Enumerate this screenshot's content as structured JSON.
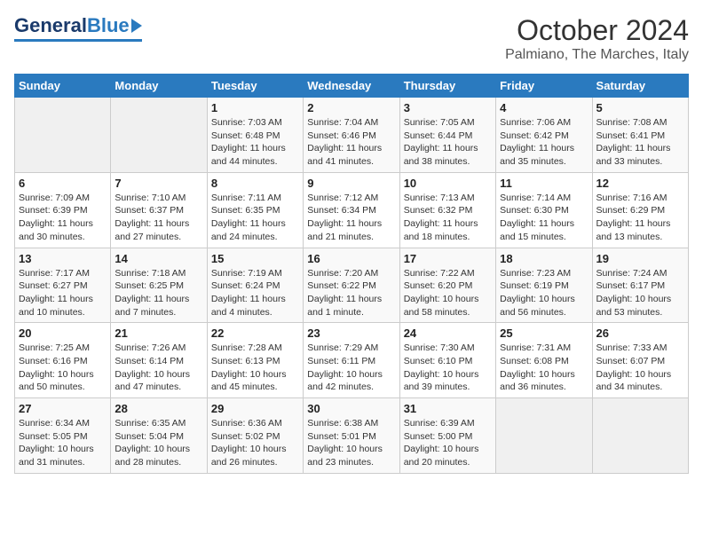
{
  "logo": {
    "general": "General",
    "blue": "Blue"
  },
  "title": "October 2024",
  "subtitle": "Palmiano, The Marches, Italy",
  "headers": [
    "Sunday",
    "Monday",
    "Tuesday",
    "Wednesday",
    "Thursday",
    "Friday",
    "Saturday"
  ],
  "weeks": [
    [
      {
        "day": "",
        "sunrise": "",
        "sunset": "",
        "daylight": ""
      },
      {
        "day": "",
        "sunrise": "",
        "sunset": "",
        "daylight": ""
      },
      {
        "day": "1",
        "sunrise": "Sunrise: 7:03 AM",
        "sunset": "Sunset: 6:48 PM",
        "daylight": "Daylight: 11 hours and 44 minutes."
      },
      {
        "day": "2",
        "sunrise": "Sunrise: 7:04 AM",
        "sunset": "Sunset: 6:46 PM",
        "daylight": "Daylight: 11 hours and 41 minutes."
      },
      {
        "day": "3",
        "sunrise": "Sunrise: 7:05 AM",
        "sunset": "Sunset: 6:44 PM",
        "daylight": "Daylight: 11 hours and 38 minutes."
      },
      {
        "day": "4",
        "sunrise": "Sunrise: 7:06 AM",
        "sunset": "Sunset: 6:42 PM",
        "daylight": "Daylight: 11 hours and 35 minutes."
      },
      {
        "day": "5",
        "sunrise": "Sunrise: 7:08 AM",
        "sunset": "Sunset: 6:41 PM",
        "daylight": "Daylight: 11 hours and 33 minutes."
      }
    ],
    [
      {
        "day": "6",
        "sunrise": "Sunrise: 7:09 AM",
        "sunset": "Sunset: 6:39 PM",
        "daylight": "Daylight: 11 hours and 30 minutes."
      },
      {
        "day": "7",
        "sunrise": "Sunrise: 7:10 AM",
        "sunset": "Sunset: 6:37 PM",
        "daylight": "Daylight: 11 hours and 27 minutes."
      },
      {
        "day": "8",
        "sunrise": "Sunrise: 7:11 AM",
        "sunset": "Sunset: 6:35 PM",
        "daylight": "Daylight: 11 hours and 24 minutes."
      },
      {
        "day": "9",
        "sunrise": "Sunrise: 7:12 AM",
        "sunset": "Sunset: 6:34 PM",
        "daylight": "Daylight: 11 hours and 21 minutes."
      },
      {
        "day": "10",
        "sunrise": "Sunrise: 7:13 AM",
        "sunset": "Sunset: 6:32 PM",
        "daylight": "Daylight: 11 hours and 18 minutes."
      },
      {
        "day": "11",
        "sunrise": "Sunrise: 7:14 AM",
        "sunset": "Sunset: 6:30 PM",
        "daylight": "Daylight: 11 hours and 15 minutes."
      },
      {
        "day": "12",
        "sunrise": "Sunrise: 7:16 AM",
        "sunset": "Sunset: 6:29 PM",
        "daylight": "Daylight: 11 hours and 13 minutes."
      }
    ],
    [
      {
        "day": "13",
        "sunrise": "Sunrise: 7:17 AM",
        "sunset": "Sunset: 6:27 PM",
        "daylight": "Daylight: 11 hours and 10 minutes."
      },
      {
        "day": "14",
        "sunrise": "Sunrise: 7:18 AM",
        "sunset": "Sunset: 6:25 PM",
        "daylight": "Daylight: 11 hours and 7 minutes."
      },
      {
        "day": "15",
        "sunrise": "Sunrise: 7:19 AM",
        "sunset": "Sunset: 6:24 PM",
        "daylight": "Daylight: 11 hours and 4 minutes."
      },
      {
        "day": "16",
        "sunrise": "Sunrise: 7:20 AM",
        "sunset": "Sunset: 6:22 PM",
        "daylight": "Daylight: 11 hours and 1 minute."
      },
      {
        "day": "17",
        "sunrise": "Sunrise: 7:22 AM",
        "sunset": "Sunset: 6:20 PM",
        "daylight": "Daylight: 10 hours and 58 minutes."
      },
      {
        "day": "18",
        "sunrise": "Sunrise: 7:23 AM",
        "sunset": "Sunset: 6:19 PM",
        "daylight": "Daylight: 10 hours and 56 minutes."
      },
      {
        "day": "19",
        "sunrise": "Sunrise: 7:24 AM",
        "sunset": "Sunset: 6:17 PM",
        "daylight": "Daylight: 10 hours and 53 minutes."
      }
    ],
    [
      {
        "day": "20",
        "sunrise": "Sunrise: 7:25 AM",
        "sunset": "Sunset: 6:16 PM",
        "daylight": "Daylight: 10 hours and 50 minutes."
      },
      {
        "day": "21",
        "sunrise": "Sunrise: 7:26 AM",
        "sunset": "Sunset: 6:14 PM",
        "daylight": "Daylight: 10 hours and 47 minutes."
      },
      {
        "day": "22",
        "sunrise": "Sunrise: 7:28 AM",
        "sunset": "Sunset: 6:13 PM",
        "daylight": "Daylight: 10 hours and 45 minutes."
      },
      {
        "day": "23",
        "sunrise": "Sunrise: 7:29 AM",
        "sunset": "Sunset: 6:11 PM",
        "daylight": "Daylight: 10 hours and 42 minutes."
      },
      {
        "day": "24",
        "sunrise": "Sunrise: 7:30 AM",
        "sunset": "Sunset: 6:10 PM",
        "daylight": "Daylight: 10 hours and 39 minutes."
      },
      {
        "day": "25",
        "sunrise": "Sunrise: 7:31 AM",
        "sunset": "Sunset: 6:08 PM",
        "daylight": "Daylight: 10 hours and 36 minutes."
      },
      {
        "day": "26",
        "sunrise": "Sunrise: 7:33 AM",
        "sunset": "Sunset: 6:07 PM",
        "daylight": "Daylight: 10 hours and 34 minutes."
      }
    ],
    [
      {
        "day": "27",
        "sunrise": "Sunrise: 6:34 AM",
        "sunset": "Sunset: 5:05 PM",
        "daylight": "Daylight: 10 hours and 31 minutes."
      },
      {
        "day": "28",
        "sunrise": "Sunrise: 6:35 AM",
        "sunset": "Sunset: 5:04 PM",
        "daylight": "Daylight: 10 hours and 28 minutes."
      },
      {
        "day": "29",
        "sunrise": "Sunrise: 6:36 AM",
        "sunset": "Sunset: 5:02 PM",
        "daylight": "Daylight: 10 hours and 26 minutes."
      },
      {
        "day": "30",
        "sunrise": "Sunrise: 6:38 AM",
        "sunset": "Sunset: 5:01 PM",
        "daylight": "Daylight: 10 hours and 23 minutes."
      },
      {
        "day": "31",
        "sunrise": "Sunrise: 6:39 AM",
        "sunset": "Sunset: 5:00 PM",
        "daylight": "Daylight: 10 hours and 20 minutes."
      },
      {
        "day": "",
        "sunrise": "",
        "sunset": "",
        "daylight": ""
      },
      {
        "day": "",
        "sunrise": "",
        "sunset": "",
        "daylight": ""
      }
    ]
  ]
}
